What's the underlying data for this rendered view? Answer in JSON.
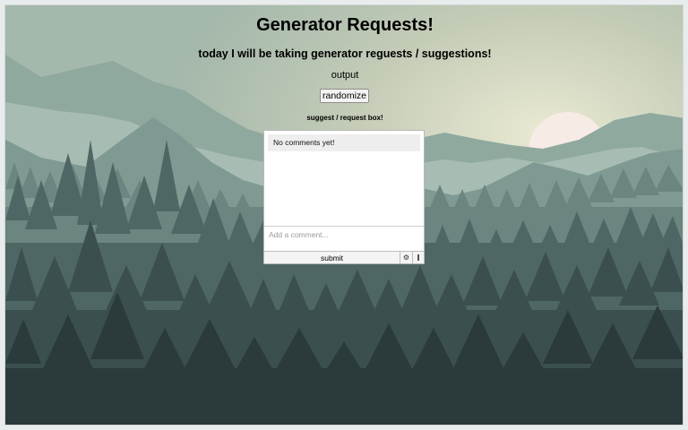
{
  "page": {
    "title": "Generator Requests!",
    "subtitle": "today I will be taking generator reguests / suggestions!",
    "output_text": "output"
  },
  "controls": {
    "randomize_label": "randomize"
  },
  "comments": {
    "box_label": "suggest / request box!",
    "empty_message": "No comments yet!",
    "input_placeholder": "Add a comment...",
    "submit_label": "submit",
    "settings_icon": "gear-icon",
    "menu_icon": "vertical-bar-icon"
  },
  "colors": {
    "sky_top": "#9fb5a8",
    "sky_glow": "#e3e4cd",
    "sun": "#f8ece6",
    "forest_dark": "#2b3a3a"
  }
}
